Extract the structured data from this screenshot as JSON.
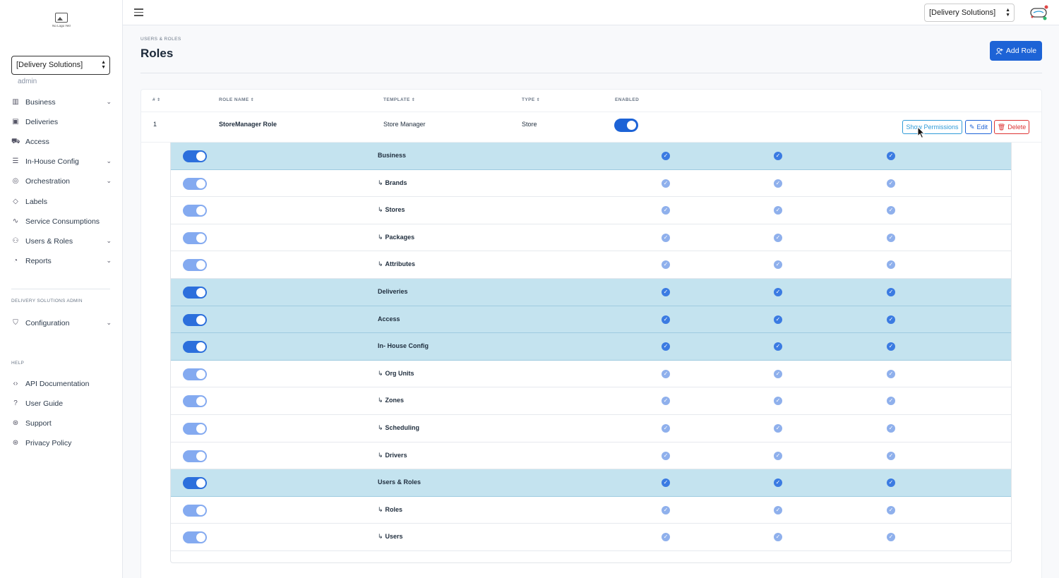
{
  "sidebar": {
    "logo_caption": "No Logo Yet!",
    "org_select": "[Delivery Solutions]",
    "role_label": "admin",
    "items": [
      {
        "label": "Business",
        "icon": "building-icon",
        "has_chevron": true
      },
      {
        "label": "Deliveries",
        "icon": "box-icon",
        "has_chevron": false
      },
      {
        "label": "Access",
        "icon": "truck-icon",
        "has_chevron": false
      },
      {
        "label": "In-House Config",
        "icon": "sliders-icon",
        "has_chevron": true
      },
      {
        "label": "Orchestration",
        "icon": "compass-icon",
        "has_chevron": true
      },
      {
        "label": "Labels",
        "icon": "tag-icon",
        "has_chevron": false
      },
      {
        "label": "Service Consumptions",
        "icon": "activity-icon",
        "has_chevron": false
      },
      {
        "label": "Users & Roles",
        "icon": "users-icon",
        "has_chevron": true
      },
      {
        "label": "Reports",
        "icon": "pie-chart-icon",
        "has_chevron": true
      }
    ],
    "admin_heading": "DELIVERY SOLUTIONS ADMIN",
    "admin_items": [
      {
        "label": "Configuration",
        "icon": "shield-icon",
        "has_chevron": true
      }
    ],
    "help_heading": "HELP",
    "help_items": [
      {
        "label": "API Documentation",
        "icon": "code-icon"
      },
      {
        "label": "User Guide",
        "icon": "help-circle-icon"
      },
      {
        "label": "Support",
        "icon": "life-buoy-icon"
      },
      {
        "label": "Privacy Policy",
        "icon": "life-buoy-icon"
      }
    ]
  },
  "topbar": {
    "org_select": "[Delivery Solutions]"
  },
  "header": {
    "breadcrumb": "USERS & ROLES",
    "title": "Roles",
    "add_button": "Add Role"
  },
  "table": {
    "columns": {
      "index": "#",
      "role_name": "ROLE NAME",
      "template": "TEMPLATE",
      "type": "TYPE",
      "enabled": "ENABLED"
    },
    "row": {
      "index": "1",
      "role_name": "StoreManager Role",
      "template": "Store Manager",
      "type": "Store",
      "enabled": true,
      "show_label": "Show Permissions",
      "edit_label": "Edit",
      "delete_label": "Delete"
    }
  },
  "permissions": [
    {
      "name": "Business",
      "parent": true,
      "enabled": true,
      "checks": [
        true,
        true,
        true
      ]
    },
    {
      "name": "Brands",
      "parent": false,
      "enabled": true,
      "checks": [
        true,
        true,
        true
      ]
    },
    {
      "name": "Stores",
      "parent": false,
      "enabled": true,
      "checks": [
        true,
        true,
        true
      ]
    },
    {
      "name": "Packages",
      "parent": false,
      "enabled": true,
      "checks": [
        true,
        true,
        true
      ]
    },
    {
      "name": "Attributes",
      "parent": false,
      "enabled": true,
      "checks": [
        true,
        true,
        true
      ]
    },
    {
      "name": "Deliveries",
      "parent": true,
      "enabled": true,
      "checks": [
        true,
        true,
        true
      ]
    },
    {
      "name": "Access",
      "parent": true,
      "enabled": true,
      "checks": [
        true,
        true,
        true
      ]
    },
    {
      "name": "In- House Config",
      "parent": true,
      "enabled": true,
      "checks": [
        true,
        true,
        true
      ]
    },
    {
      "name": "Org Units",
      "parent": false,
      "enabled": true,
      "checks": [
        true,
        true,
        true
      ]
    },
    {
      "name": "Zones",
      "parent": false,
      "enabled": true,
      "checks": [
        true,
        true,
        true
      ]
    },
    {
      "name": "Scheduling",
      "parent": false,
      "enabled": true,
      "checks": [
        true,
        true,
        true
      ]
    },
    {
      "name": "Drivers",
      "parent": false,
      "enabled": true,
      "checks": [
        true,
        true,
        true
      ]
    },
    {
      "name": "Users & Roles",
      "parent": true,
      "enabled": true,
      "checks": [
        true,
        true,
        true
      ]
    },
    {
      "name": "Roles",
      "parent": false,
      "enabled": true,
      "checks": [
        true,
        true,
        true
      ]
    },
    {
      "name": "Users",
      "parent": false,
      "enabled": true,
      "checks": [
        true,
        true,
        true
      ]
    }
  ],
  "colors": {
    "primary": "#1d63d6",
    "info": "#2f9bd8",
    "danger": "#dd3333",
    "parent_row": "#c4e3ef"
  }
}
